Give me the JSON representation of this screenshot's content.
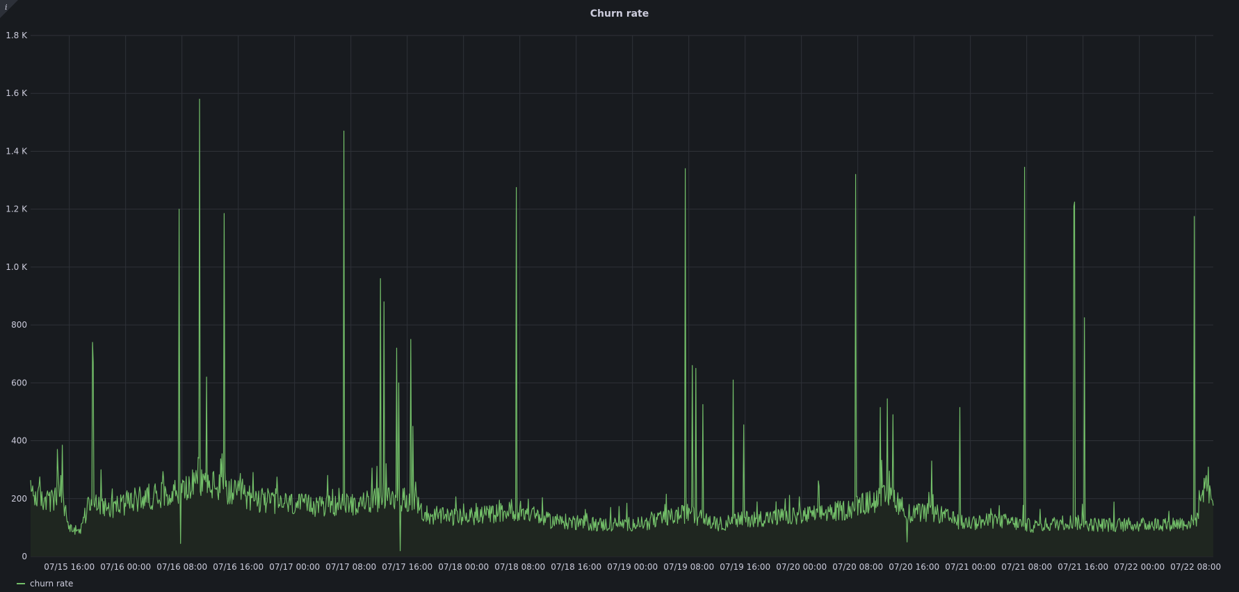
{
  "panel": {
    "title": "Churn rate",
    "info_icon": "info-icon"
  },
  "colors": {
    "background": "#181b1f",
    "grid": "#2f3238",
    "series": "#73bf69",
    "fill": "#1f2620",
    "text": "#ccccdc"
  },
  "chart_data": {
    "type": "line",
    "title": "Churn rate",
    "xlabel": "",
    "ylabel": "",
    "x_range": [
      "07/15 10:30",
      "07/22 10:30"
    ],
    "ylim": [
      0,
      1800
    ],
    "y_ticks": [
      {
        "value": 0,
        "label": "0"
      },
      {
        "value": 200,
        "label": "200"
      },
      {
        "value": 400,
        "label": "400"
      },
      {
        "value": 600,
        "label": "600"
      },
      {
        "value": 800,
        "label": "800"
      },
      {
        "value": 1000,
        "label": "1.0 K"
      },
      {
        "value": 1200,
        "label": "1.2 K"
      },
      {
        "value": 1400,
        "label": "1.4 K"
      },
      {
        "value": 1600,
        "label": "1.6 K"
      },
      {
        "value": 1800,
        "label": "1.8 K"
      }
    ],
    "x_ticks": [
      "07/15 16:00",
      "07/16 00:00",
      "07/16 08:00",
      "07/16 16:00",
      "07/17 00:00",
      "07/17 08:00",
      "07/17 16:00",
      "07/18 00:00",
      "07/18 08:00",
      "07/18 16:00",
      "07/19 00:00",
      "07/19 08:00",
      "07/19 16:00",
      "07/20 00:00",
      "07/20 08:00",
      "07/20 16:00",
      "07/21 00:00",
      "07/21 08:00",
      "07/21 16:00",
      "07/22 00:00",
      "07/22 08:00"
    ],
    "grid": true,
    "legend_position": "bottom-left",
    "series": [
      {
        "name": "churn rate",
        "color": "#73bf69",
        "baseline": [
          [
            "07/15 10:30",
            220
          ],
          [
            "07/15 13:00",
            190
          ],
          [
            "07/15 15:00",
            200
          ],
          [
            "07/15 16:00",
            100
          ],
          [
            "07/15 17:30",
            80
          ],
          [
            "07/15 19:00",
            200
          ],
          [
            "07/15 22:00",
            170
          ],
          [
            "07/16 02:00",
            200
          ],
          [
            "07/16 06:00",
            220
          ],
          [
            "07/16 08:00",
            230
          ],
          [
            "07/16 11:00",
            260
          ],
          [
            "07/16 15:00",
            220
          ],
          [
            "07/16 20:00",
            190
          ],
          [
            "07/17 02:00",
            175
          ],
          [
            "07/17 08:00",
            180
          ],
          [
            "07/17 13:00",
            200
          ],
          [
            "07/17 16:00",
            200
          ],
          [
            "07/17 19:00",
            140
          ],
          [
            "07/18 00:00",
            135
          ],
          [
            "07/18 08:00",
            160
          ],
          [
            "07/18 12:00",
            125
          ],
          [
            "07/18 20:00",
            110
          ],
          [
            "07/19 02:00",
            115
          ],
          [
            "07/19 06:00",
            140
          ],
          [
            "07/19 08:00",
            150
          ],
          [
            "07/19 12:00",
            110
          ],
          [
            "07/19 16:00",
            130
          ],
          [
            "07/20 00:00",
            140
          ],
          [
            "07/20 06:00",
            160
          ],
          [
            "07/20 10:00",
            190
          ],
          [
            "07/20 13:00",
            210
          ],
          [
            "07/20 15:00",
            150
          ],
          [
            "07/20 19:00",
            150
          ],
          [
            "07/20 23:00",
            115
          ],
          [
            "07/21 04:00",
            125
          ],
          [
            "07/21 09:00",
            105
          ],
          [
            "07/21 14:00",
            120
          ],
          [
            "07/21 18:00",
            110
          ],
          [
            "07/22 00:00",
            110
          ],
          [
            "07/22 06:00",
            115
          ],
          [
            "07/22 08:00",
            120
          ],
          [
            "07/22 09:00",
            230
          ],
          [
            "07/22 10:30",
            200
          ]
        ],
        "spikes": [
          [
            "07/15 14:20",
            370
          ],
          [
            "07/15 15:00",
            385
          ],
          [
            "07/15 19:15",
            740
          ],
          [
            "07/15 19:25",
            670
          ],
          [
            "07/16 07:35",
            1200
          ],
          [
            "07/16 07:45",
            600
          ],
          [
            "07/16 07:50",
            45
          ],
          [
            "07/16 10:30",
            1580
          ],
          [
            "07/16 11:30",
            620
          ],
          [
            "07/16 14:00",
            1185
          ],
          [
            "07/17 07:00",
            1470
          ],
          [
            "07/17 12:10",
            960
          ],
          [
            "07/17 12:40",
            880
          ],
          [
            "07/17 14:30",
            720
          ],
          [
            "07/17 14:45",
            600
          ],
          [
            "07/17 15:00",
            20
          ],
          [
            "07/17 16:30",
            750
          ],
          [
            "07/17 16:45",
            450
          ],
          [
            "07/18 07:30",
            1275
          ],
          [
            "07/19 07:30",
            1340
          ],
          [
            "07/19 08:30",
            660
          ],
          [
            "07/19 09:00",
            650
          ],
          [
            "07/19 10:00",
            525
          ],
          [
            "07/19 14:20",
            610
          ],
          [
            "07/19 15:50",
            455
          ],
          [
            "07/20 07:40",
            1320
          ],
          [
            "07/20 11:10",
            515
          ],
          [
            "07/20 12:10",
            545
          ],
          [
            "07/20 13:00",
            490
          ],
          [
            "07/20 15:00",
            50
          ],
          [
            "07/20 18:30",
            330
          ],
          [
            "07/20 22:30",
            515
          ],
          [
            "07/21 07:40",
            1345
          ],
          [
            "07/21 14:40",
            1210
          ],
          [
            "07/21 14:50",
            1225
          ],
          [
            "07/21 16:10",
            825
          ],
          [
            "07/22 07:50",
            1175
          ],
          [
            "07/22 09:30",
            280
          ]
        ]
      }
    ]
  }
}
